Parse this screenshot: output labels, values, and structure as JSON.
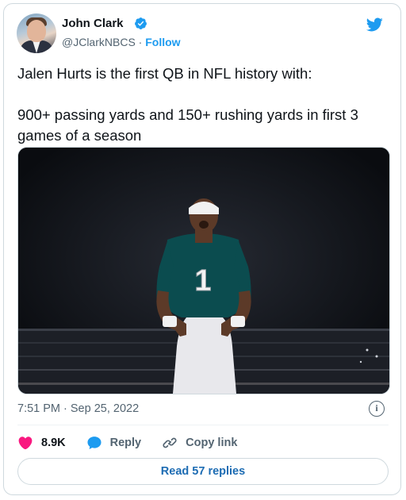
{
  "author": {
    "name": "John Clark",
    "handle": "@JClarkNBCS",
    "separator": "·",
    "follow_label": "Follow"
  },
  "tweet": {
    "text": "Jalen Hurts is the first QB in NFL history with:\n\n900+ passing yards and 150+ rushing yards in first 3 games of a season",
    "timestamp": "7:51 PM · Sep 25, 2022",
    "jersey_number": "1"
  },
  "actions": {
    "like_count": "8.9K",
    "reply_label": "Reply",
    "copy_link_label": "Copy link"
  },
  "read_replies_label": "Read 57 replies",
  "info_glyph": "i",
  "colors": {
    "accent": "#1d9bf0",
    "like": "#f91880",
    "muted": "#536471",
    "jersey": "#0b4c4f"
  },
  "icons": [
    "verified-badge-icon",
    "twitter-bird-icon",
    "info-icon",
    "heart-icon",
    "reply-bubble-icon",
    "link-icon"
  ]
}
